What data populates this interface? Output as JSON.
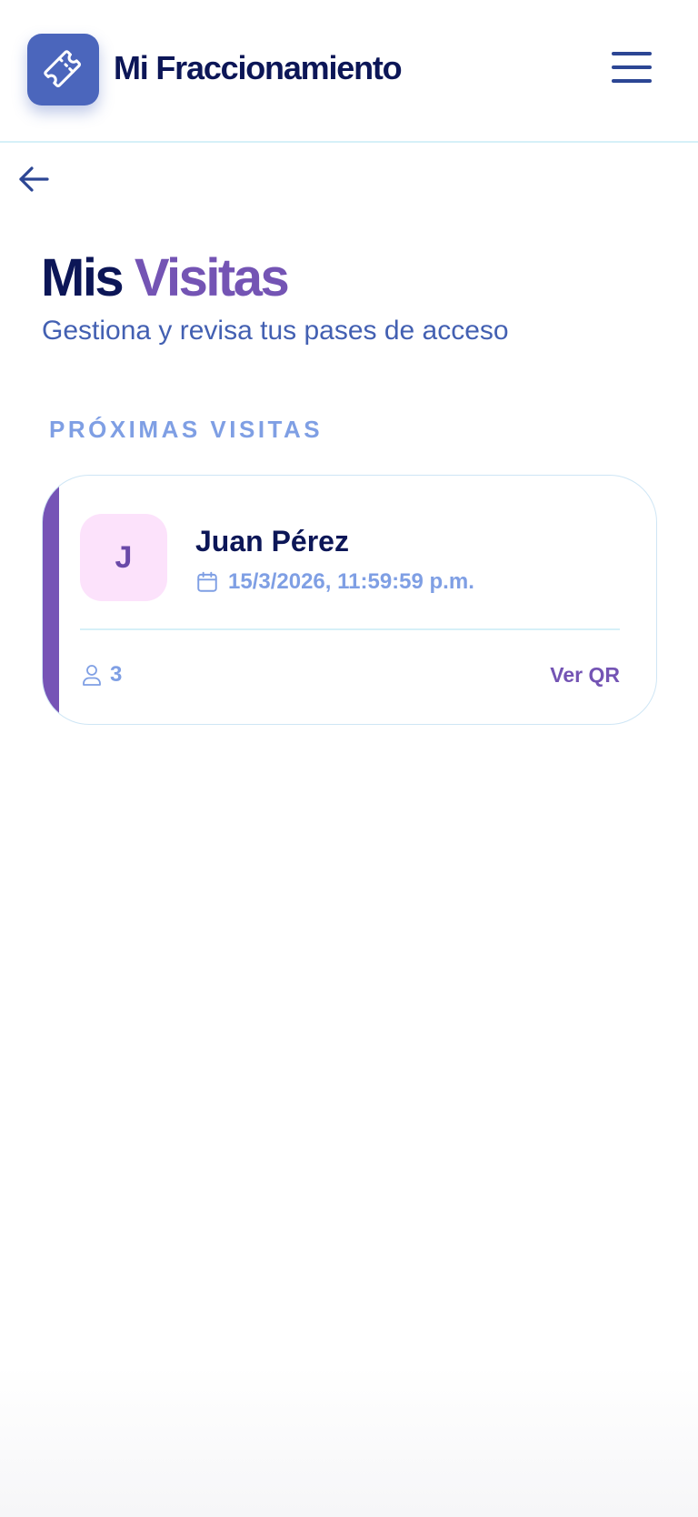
{
  "header": {
    "app_title": "Mi Fraccionamiento",
    "logo_icon": "ticket-icon",
    "menu_icon": "hamburger-menu-icon"
  },
  "navigation": {
    "back_icon": "arrow-left-icon"
  },
  "page": {
    "title_part1": "Mis",
    "title_part2": "Visitas",
    "subtitle": "Gestiona y revisa tus pases de acceso"
  },
  "section": {
    "label": "PRÓXIMAS VISITAS"
  },
  "visits": [
    {
      "initial": "J",
      "name": "Juan Pérez",
      "datetime": "15/3/2026, 11:59:59 p.m.",
      "guests": "3",
      "action_label": "Ver QR"
    }
  ],
  "colors": {
    "brand": "#4b66bc",
    "navy": "#0c1657",
    "purple": "#7454b4",
    "light_blue": "#7f9fe4",
    "subtitle_blue": "#4360b2",
    "avatar_bg": "#fce2fb",
    "divider": "#d6f0f8"
  }
}
